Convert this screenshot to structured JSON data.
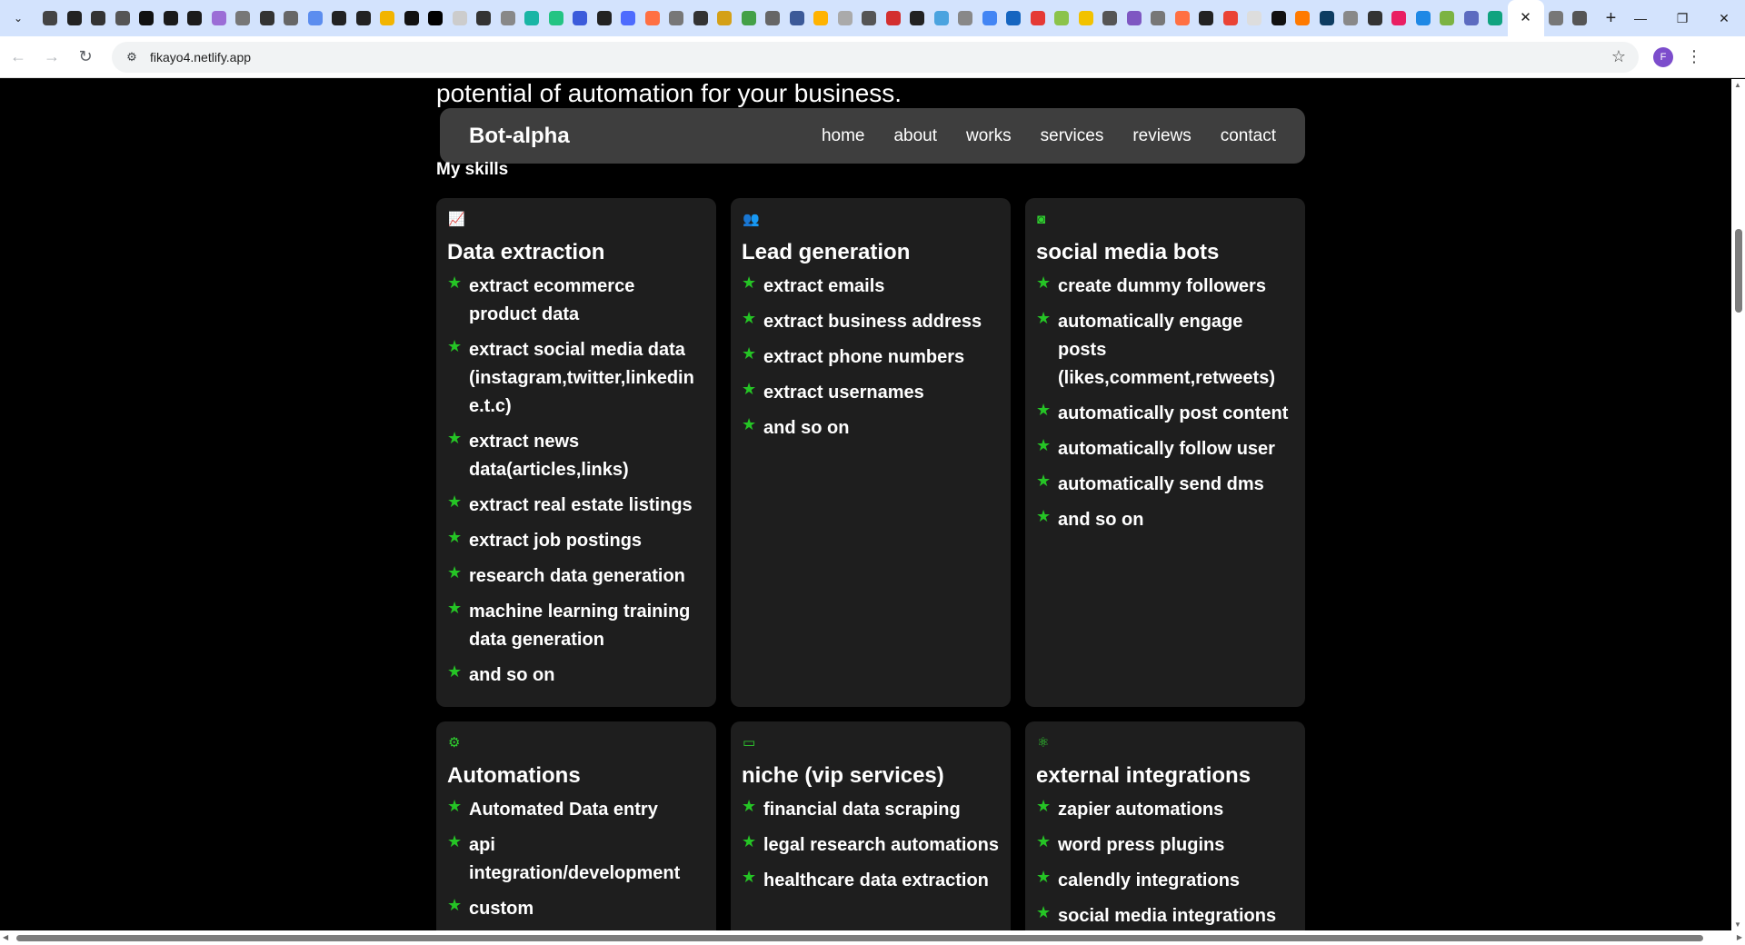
{
  "browser": {
    "url": "fikayo4.netlify.app",
    "active_tab_close": "✕",
    "new_tab": "+",
    "avatar_initial": "F",
    "favicon_colors": [
      "#444",
      "#222",
      "#333",
      "#555",
      "#111",
      "#1a1a1a",
      "#1b1b1b",
      "#9b6dd6",
      "#777",
      "#333",
      "#666",
      "#5b8def",
      "#222",
      "#222",
      "#f2b400",
      "#111",
      "#000",
      "#cccccc",
      "#333",
      "#888",
      "#19b5a5",
      "#23c483",
      "#3b5bdb",
      "#222",
      "#4d6bfe",
      "#ff7043",
      "#777",
      "#333",
      "#d4a017",
      "#43a047",
      "#666",
      "#3b5998",
      "#ffb300",
      "#aaa",
      "#555",
      "#d32f2f",
      "#222",
      "#4aa3df",
      "#888",
      "#4285f4",
      "#1565c0",
      "#e53935",
      "#8bc34a",
      "#f2c200",
      "#555",
      "#7e57c2",
      "#777",
      "#ff7043",
      "#222",
      "#ea4335",
      "#ddd",
      "#111",
      "#ff7a00",
      "#0d3c61",
      "#888",
      "#333",
      "#e91e63",
      "#1e88e5",
      "#7cb342",
      "#5c6bc0",
      "#10a37f",
      "#777",
      "#555"
    ]
  },
  "page": {
    "hero_tail": "potential of automation for your business.",
    "brand": "Bot-alpha",
    "nav": [
      "home",
      "about",
      "works",
      "services",
      "reviews",
      "contact"
    ],
    "section_title": "My skills",
    "accent_color": "#2fd12f",
    "cards": [
      {
        "icon": "chart-icon",
        "title": "Data extraction",
        "items": [
          "extract ecommerce product data",
          "extract social media data (instagram,twitter,linkedin e.t.c)",
          "extract news data(articles,links)",
          "extract real estate listings",
          "extract job postings",
          "research data generation",
          "machine learning training data generation",
          "and so on"
        ]
      },
      {
        "icon": "users-icon",
        "title": "Lead generation",
        "items": [
          "extract emails",
          "extract business address",
          "extract phone numbers",
          "extract usernames",
          "and so on"
        ]
      },
      {
        "icon": "instagram-icon",
        "title": "social media bots",
        "items": [
          "create dummy followers",
          "automatically engage posts (likes,comment,retweets)",
          "automatically post content",
          "automatically follow user",
          "automatically send dms",
          "and so on"
        ]
      },
      {
        "icon": "robot-arm-icon",
        "title": "Automations",
        "items": [
          "Automated Data entry",
          "api integration/development",
          "custom"
        ]
      },
      {
        "icon": "vip-icon",
        "title": "niche (vip services)",
        "items": [
          "financial data scraping",
          "legal research automations",
          "healthcare data extraction"
        ]
      },
      {
        "icon": "integration-icon",
        "title": "external integrations",
        "items": [
          "zapier automations",
          "word press plugins",
          "calendly integrations",
          "social media integrations"
        ]
      }
    ]
  }
}
